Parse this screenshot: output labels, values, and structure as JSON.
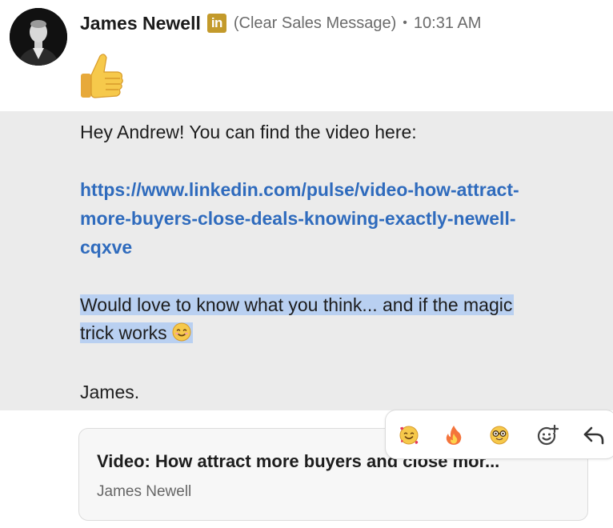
{
  "message": {
    "sender": "James Newell",
    "badge_text": "in",
    "subtitle": "(Clear Sales Message)",
    "separator": "•",
    "time": "10:31 AM",
    "reaction_emoji": "thumbs-up",
    "greeting": "Hey Andrew! You can find the video here:",
    "link_lines": [
      "https://www.linkedin.com/pulse/video-how-attract-",
      "more-buyers-close-deals-knowing-exactly-newell-",
      "cqxve"
    ],
    "selected_lines": [
      "Would love to know what you think... and if the magic",
      "trick works"
    ],
    "signoff": "James."
  },
  "reactions": [
    "smiling-face-with-hearts",
    "fire",
    "nerd-face",
    "add-reaction",
    "reply"
  ],
  "preview_card": {
    "title": "Video: How attract more buyers and close mor...",
    "author": "James Newell"
  },
  "colors": {
    "link": "#2f6bbd",
    "selection": "#b9d0f1",
    "message_bg": "#ebebeb",
    "badge": "#c39a2b"
  }
}
